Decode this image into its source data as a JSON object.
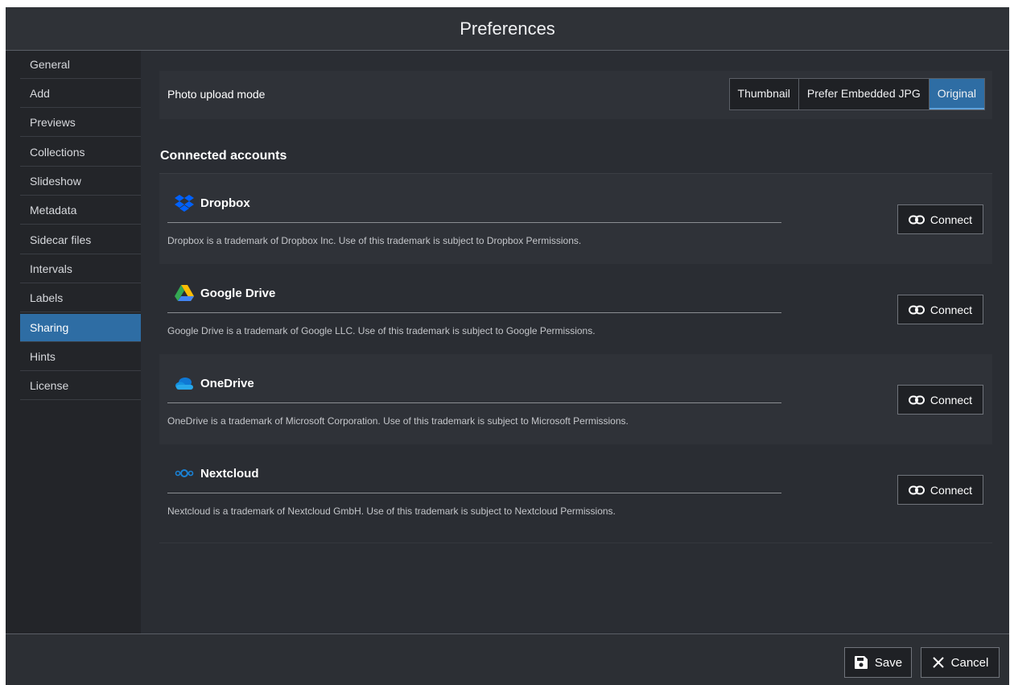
{
  "dialog": {
    "title": "Preferences"
  },
  "sidebar": {
    "items": [
      {
        "label": "General"
      },
      {
        "label": "Add"
      },
      {
        "label": "Previews"
      },
      {
        "label": "Collections"
      },
      {
        "label": "Slideshow"
      },
      {
        "label": "Metadata"
      },
      {
        "label": "Sidecar files"
      },
      {
        "label": "Intervals"
      },
      {
        "label": "Labels"
      },
      {
        "label": "Sharing",
        "active": true
      },
      {
        "label": "Hints"
      },
      {
        "label": "License"
      }
    ]
  },
  "upload": {
    "label": "Photo upload mode",
    "options": [
      "Thumbnail",
      "Prefer Embedded JPG",
      "Original"
    ],
    "selected": "Original"
  },
  "accounts": {
    "title": "Connected accounts",
    "connect_label": "Connect",
    "items": [
      {
        "name": "Dropbox",
        "icon": "dropbox-icon",
        "description": "Dropbox is a trademark of Dropbox Inc. Use of this trademark is subject to Dropbox Permissions."
      },
      {
        "name": "Google Drive",
        "icon": "google-drive-icon",
        "description": "Google Drive is a trademark of Google LLC. Use of this trademark is subject to Google Permissions."
      },
      {
        "name": "OneDrive",
        "icon": "onedrive-icon",
        "description": "OneDrive is a trademark of Microsoft Corporation. Use of this trademark is subject to Microsoft Permissions."
      },
      {
        "name": "Nextcloud",
        "icon": "nextcloud-icon",
        "description": "Nextcloud is a trademark of Nextcloud GmbH. Use of this trademark is subject to Nextcloud Permissions."
      }
    ]
  },
  "footer": {
    "save_label": "Save",
    "cancel_label": "Cancel"
  },
  "colors": {
    "accent": "#2e6da4",
    "background": "#2a2d33",
    "sidebar": "#232529"
  }
}
